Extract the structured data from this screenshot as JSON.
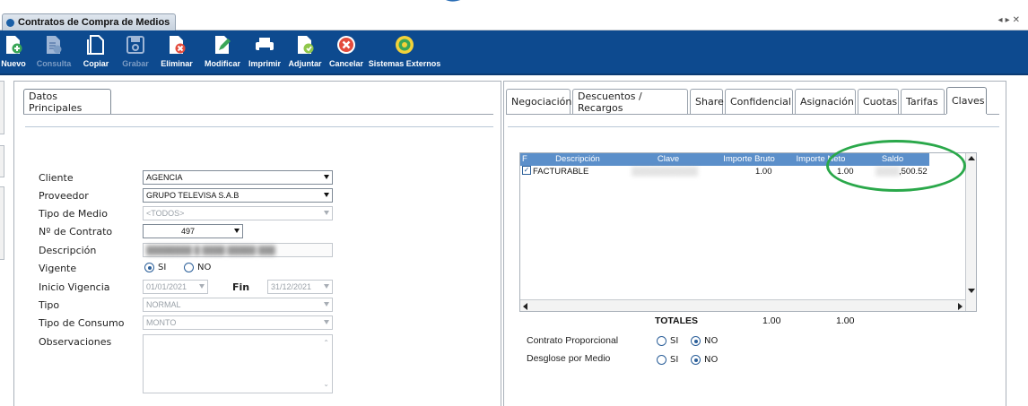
{
  "window": {
    "title": "Contratos de Compra de Medios"
  },
  "toolbar": {
    "buttons": [
      {
        "label": "Nuevo",
        "icon": "new-document-icon",
        "enabled": true
      },
      {
        "label": "Consulta",
        "icon": "query-document-icon",
        "enabled": false
      },
      {
        "label": "Copiar",
        "icon": "copy-icon",
        "enabled": true
      },
      {
        "label": "Grabar",
        "icon": "save-icon",
        "enabled": false
      },
      {
        "label": "Eliminar",
        "icon": "delete-document-icon",
        "enabled": true
      },
      {
        "label": "Modificar",
        "icon": "edit-icon",
        "enabled": true
      },
      {
        "label": "Imprimir",
        "icon": "printer-icon",
        "enabled": true
      },
      {
        "label": "Adjuntar",
        "icon": "attach-icon",
        "enabled": true
      },
      {
        "label": "Cancelar",
        "icon": "cancel-icon",
        "enabled": true
      },
      {
        "label": "Sistemas Externos",
        "icon": "external-systems-icon",
        "enabled": true
      }
    ]
  },
  "left_panel": {
    "tab": "Datos Principales",
    "fields": {
      "cliente": {
        "label": "Cliente",
        "value": "AGENCIA"
      },
      "proveedor": {
        "label": "Proveedor",
        "value": "GRUPO TELEVISA S.A.B"
      },
      "tipo_medio": {
        "label": "Tipo de Medio",
        "value": "<TODOS>"
      },
      "contrato": {
        "label": "Nº de Contrato",
        "value": "497"
      },
      "descripcion": {
        "label": "Descripción",
        "value": ""
      },
      "vigente": {
        "label": "Vigente",
        "options": [
          "SI",
          "NO"
        ],
        "selected": "SI"
      },
      "inicio_vigencia": {
        "label": "Inicio Vigencia",
        "value": "01/01/2021"
      },
      "fin": {
        "label": "Fin",
        "value": "31/12/2021"
      },
      "tipo": {
        "label": "Tipo",
        "value": "NORMAL"
      },
      "tipo_consumo": {
        "label": "Tipo de Consumo",
        "value": "MONTO"
      },
      "observaciones": {
        "label": "Observaciones",
        "value": ""
      }
    }
  },
  "right_panel": {
    "tabs": [
      "Negociación",
      "Descuentos / Recargos",
      "Share",
      "Confidencial",
      "Asignación",
      "Cuotas",
      "Tarifas",
      "Claves"
    ],
    "active_tab": "Claves",
    "grid": {
      "columns": [
        "F",
        "Descripción",
        "Clave",
        "Importe Bruto",
        "Importe Neto",
        "Saldo"
      ],
      "rows": [
        {
          "checked": true,
          "descripcion": "FACTURABLE",
          "clave": "",
          "importe_bruto": "1.00",
          "importe_neto": "1.00",
          "saldo": ",500.52"
        }
      ]
    },
    "totals": {
      "label": "TOTALES",
      "bruto": "1.00",
      "neto": "1.00"
    },
    "contrato_proporcional": {
      "label": "Contrato Proporcional",
      "options": [
        "SI",
        "NO"
      ],
      "selected": "NO"
    },
    "desglose_medio": {
      "label": "Desglose por Medio",
      "options": [
        "SI",
        "NO"
      ],
      "selected": "NO"
    }
  },
  "colors": {
    "toolbar_bg": "#0d4a8f",
    "grid_header": "#5b8fca",
    "highlight": "#2aa84a"
  }
}
